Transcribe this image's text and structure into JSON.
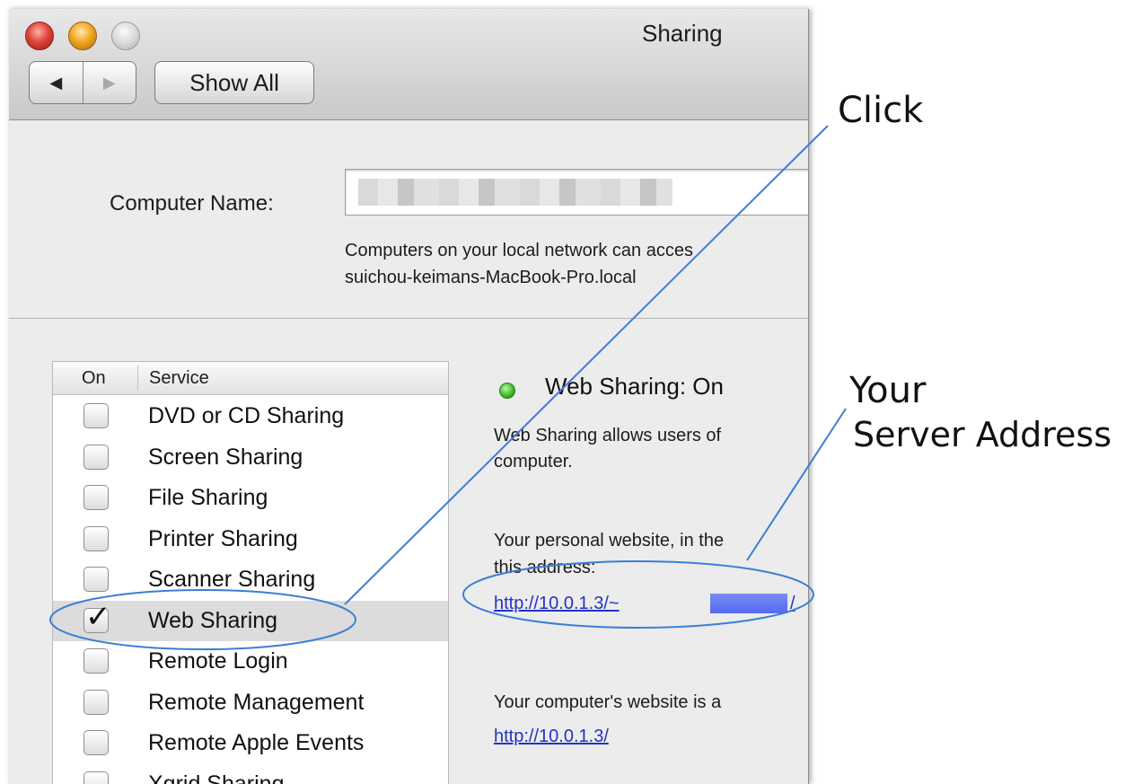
{
  "window": {
    "title": "Sharing",
    "nav_back_icon": "◀",
    "nav_forward_icon": "▶",
    "show_all_label": "Show All"
  },
  "computer_name": {
    "label": "Computer Name:",
    "value": "",
    "description_line1": "Computers on your local network can acces",
    "description_line2": "suichou-keimans-MacBook-Pro.local"
  },
  "services": {
    "header_on": "On",
    "header_service": "Service",
    "items": [
      {
        "name": "DVD or CD Sharing",
        "checked": false
      },
      {
        "name": "Screen Sharing",
        "checked": false
      },
      {
        "name": "File Sharing",
        "checked": false
      },
      {
        "name": "Printer Sharing",
        "checked": false
      },
      {
        "name": "Scanner Sharing",
        "checked": false
      },
      {
        "name": "Web Sharing",
        "checked": true
      },
      {
        "name": "Remote Login",
        "checked": false
      },
      {
        "name": "Remote Management",
        "checked": false
      },
      {
        "name": "Remote Apple Events",
        "checked": false
      },
      {
        "name": "Xgrid Sharing",
        "checked": false
      }
    ],
    "check_glyph": "✓"
  },
  "detail": {
    "status": "Web Sharing: On",
    "status_color": "#42bb29",
    "desc_line1": "Web Sharing allows users of",
    "desc_line2": "computer.",
    "personal_line1": "Your personal website, in the",
    "personal_line2": "this address:",
    "personal_url": "http://10.0.1.3/~",
    "personal_url_tail": "/",
    "computer_line": "Your computer's website is a",
    "computer_url": "http://10.0.1.3/"
  },
  "annotations": {
    "click_label": "Click",
    "server_line1": "Your",
    "server_line2": "Server Address",
    "line_color": "#3a7fd6"
  }
}
